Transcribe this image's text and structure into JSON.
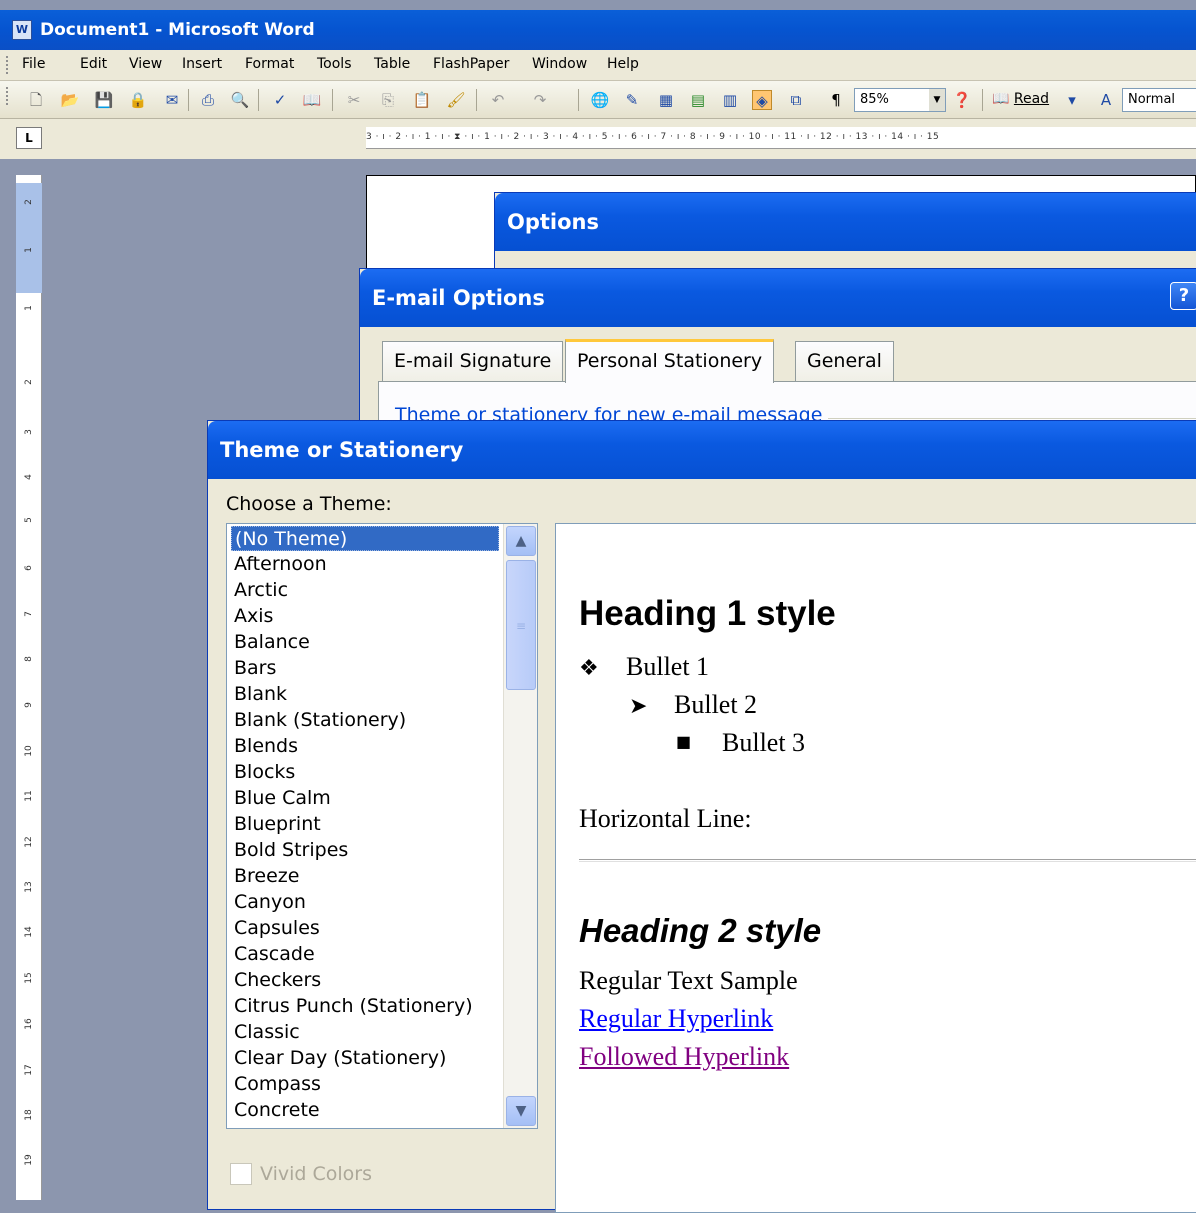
{
  "window": {
    "title": "Document1 - Microsoft Word",
    "app_icon": "word-icon"
  },
  "menubar": {
    "items": [
      "File",
      "Edit",
      "View",
      "Insert",
      "Format",
      "Tools",
      "Table",
      "FlashPaper",
      "Window",
      "Help"
    ]
  },
  "toolbar": {
    "zoom": "85%",
    "read_label": "Read",
    "style_value": "Normal"
  },
  "ruler": {
    "horizontal": "3 · ı · 2 · ı · 1 · ı · ⧗ · ı · 1 · ı · 2 · ı · 3 · ı · 4 · ı · 5 · ı · 6 · ı · 7 · ı · 8 · ı · 9 · ı · 10 · ı · 11 · ı · 12 · ı · 13 · ı · 14 · ı · 15",
    "vertical": [
      "2",
      "1",
      "1",
      "2",
      "3",
      "4",
      "5",
      "6",
      "7",
      "8",
      "9",
      "10",
      "11",
      "12",
      "13",
      "14",
      "15",
      "16",
      "17",
      "18",
      "19"
    ]
  },
  "options_dialog": {
    "title": "Options"
  },
  "email_dialog": {
    "title": "E-mail Options",
    "tabs": [
      "E-mail Signature",
      "Personal Stationery",
      "General"
    ],
    "active_tab": "Personal Stationery",
    "group_label": "Theme or stationery for new e-mail message"
  },
  "theme_dialog": {
    "title": "Theme or Stationery",
    "choose_label": "Choose a Theme:",
    "themes": [
      "(No Theme)",
      "Afternoon",
      "Arctic",
      "Axis",
      "Balance",
      "Bars",
      "Blank",
      "Blank (Stationery)",
      "Blends",
      "Blocks",
      "Blue Calm",
      "Blueprint",
      "Bold Stripes",
      "Breeze",
      "Canyon",
      "Capsules",
      "Cascade",
      "Checkers",
      "Citrus Punch (Stationery)",
      "Classic",
      "Clear Day (Stationery)",
      "Compass",
      "Concrete"
    ],
    "selected": "(No Theme)",
    "vivid_colors": "Vivid Colors",
    "preview": {
      "heading1": "Heading 1 style",
      "bullet1": "Bullet 1",
      "bullet2": "Bullet 2",
      "bullet3": "Bullet 3",
      "hline_label": "Horizontal Line:",
      "heading2": "Heading 2 style",
      "regular_text": "Regular Text Sample",
      "regular_link": "Regular Hyperlink",
      "followed_link": "Followed Hyperlink"
    }
  },
  "colors": {
    "titlebar": "#0654d0",
    "selection": "#316ac5",
    "link": "#0000ff",
    "followed_link": "#800080",
    "dialog_bg": "#ece9d8"
  }
}
